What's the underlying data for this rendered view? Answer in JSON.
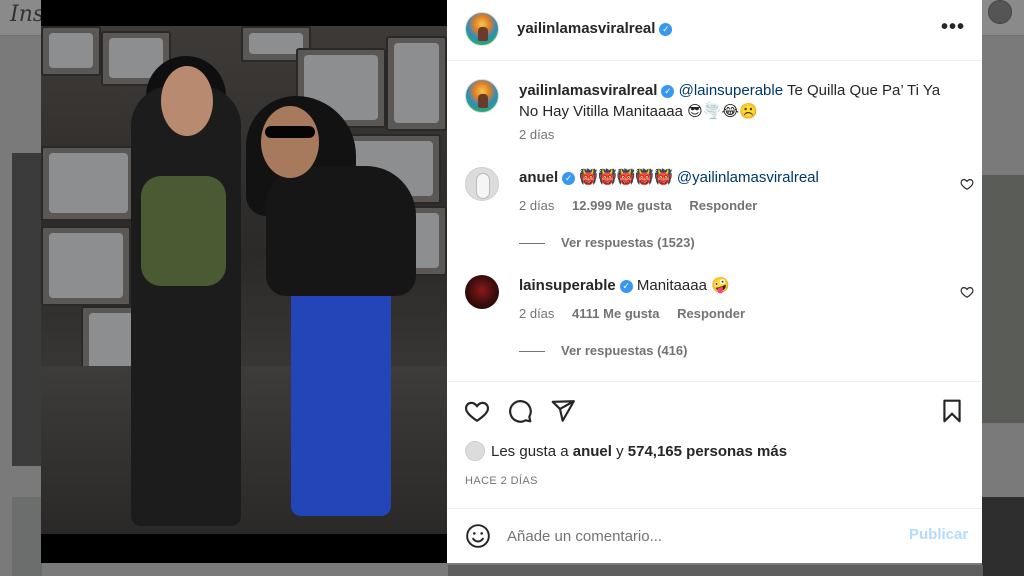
{
  "post": {
    "username": "yailinlamasviralreal",
    "verified_glyph": "✓",
    "more_glyph": "•••",
    "caption": {
      "mention": "@lainsuperable",
      "text": "Te Quilla Que Pa’ Ti Ya No Hay Vitilla Manitaaaa 😎🌪️😂☹️",
      "time": "2 días"
    }
  },
  "comments": [
    {
      "username": "anuel",
      "text": "👹👹👹👹👹",
      "mention": "@yailinlamasviralreal",
      "time": "2 días",
      "likes": "12.999 Me gusta",
      "reply": "Responder",
      "view_replies": "Ver respuestas (1523)"
    },
    {
      "username": "lainsuperable",
      "text": "Manitaaaa 🤪",
      "time": "2 días",
      "likes": "4111 Me gusta",
      "reply": "Responder",
      "view_replies": "Ver respuestas (416)"
    }
  ],
  "likes_summary": {
    "prefix": "Les gusta a",
    "user": "anuel",
    "joiner": "y",
    "rest": "574,165 personas más"
  },
  "timestamp": "HACE 2 DÍAS",
  "comment_box": {
    "placeholder": "Añade un comentario...",
    "publish": "Publicar"
  },
  "background": {
    "logo": "Ins"
  },
  "colors": {
    "verified": "#3897f0",
    "link": "#00376b",
    "publish_disabled": "#b3dbff"
  },
  "icons": [
    "heart-icon",
    "comment-icon",
    "share-icon",
    "bookmark-icon",
    "emoji-icon",
    "more-icon"
  ]
}
